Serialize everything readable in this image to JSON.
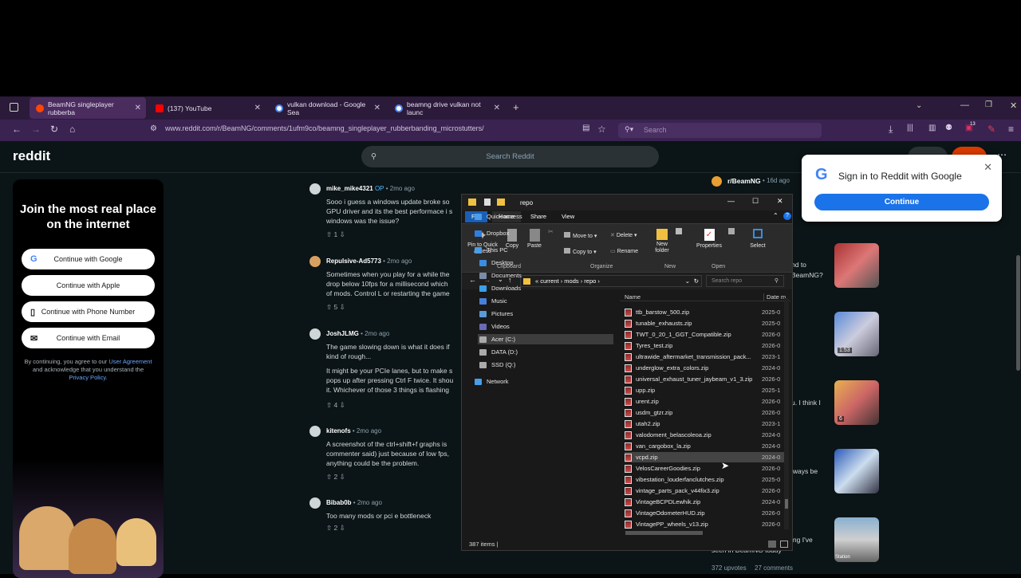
{
  "browser": {
    "tabs": [
      {
        "title": "BeamNG singleplayer rubberba",
        "color": "#ff4500"
      },
      {
        "title": "(137) YouTube",
        "color": "#ff0000"
      },
      {
        "title": "vulkan download - Google Sea",
        "color": "#4285f4"
      },
      {
        "title": "beamng drive vulkan not launc",
        "color": "#4285f4"
      }
    ],
    "url": "www.reddit.com/r/BeamNG/comments/1ufm9co/beamng_singleplayer_rubberbanding_microstutters/",
    "search_placeholder": "Search",
    "badge_count": "13"
  },
  "reddit": {
    "logo": "reddit",
    "search_placeholder": "Search Reddit",
    "join": {
      "title": "Join the most real place on the internet",
      "buttons": [
        "Continue with Google",
        "Continue with Apple",
        "Continue with Phone Number",
        "Continue with Email"
      ],
      "terms_pre": "By continuing, you agree to our",
      "terms_link1": "User Agreement",
      "terms_mid": "and acknowledge that you understand the",
      "terms_link2": "Privacy Policy."
    },
    "comments": [
      {
        "user": "mike_mike4321",
        "op": "OP",
        "time": "• 2mo ago",
        "lines": [
          "Sooo i guess a windows update broke so",
          "GPU driver and its the best performace i s",
          "windows was the issue?"
        ],
        "votes": "1"
      },
      {
        "user": "Repulsive-Ad5773",
        "op": "",
        "time": "• 2mo ago",
        "lines": [
          "Sometimes when you play for a while the",
          "drop below 10fps for a millisecond which",
          "of mods. Control L or restarting the game"
        ],
        "votes": "5"
      },
      {
        "user": "JoshJLMG",
        "op": "",
        "time": "• 2mo ago",
        "lines": [
          "The game slowing down is what it does if",
          "kind of rough...",
          "",
          "It might be your PCIe lanes, but to make s",
          "pops up after pressing Ctrl F twice. It shou",
          "it. Whichever of those 3 things is flashing"
        ],
        "votes": "4"
      },
      {
        "user": "kitenofs",
        "op": "",
        "time": "• 2mo ago",
        "lines": [
          "A screenshot of the ctrl+shift+f graphs is",
          "commenter said) just because of low fps,",
          "anything could be the problem."
        ],
        "votes": "2"
      },
      {
        "user": "Bibab0b",
        "op": "",
        "time": "• 2mo ago",
        "lines": [
          "Too many mods or pci e bottleneck"
        ],
        "votes": "2"
      }
    ],
    "side": {
      "subreddit": "r/BeamNG",
      "time": "• 16d ago",
      "snippets": [
        "nd to",
        "BeamNG?",
        "u. I think I",
        "lways be",
        "ing I've",
        "seen in BeamNG today"
      ],
      "video_time": "1:53",
      "gallery_count": "6",
      "thumb_label": "Station",
      "upvotes": "372 upvotes",
      "comments": "27 comments"
    }
  },
  "google_signin": {
    "title": "Sign in to Reddit with Google",
    "button": "Continue"
  },
  "explorer": {
    "title": "repo",
    "tabs": [
      "File",
      "Home",
      "Share",
      "View"
    ],
    "ribbon": {
      "pin": "Pin to Quick access",
      "copy": "Copy",
      "paste": "Paste",
      "move_to": "Move to",
      "copy_to": "Copy to",
      "delete": "Delete",
      "rename": "Rename",
      "new_folder": "New folder",
      "properties": "Properties",
      "select": "Select",
      "groups": [
        "Clipboard",
        "Organize",
        "New",
        "Open"
      ]
    },
    "path": [
      "current",
      "mods",
      "repo"
    ],
    "search_placeholder": "Search repo",
    "nav": [
      {
        "label": "Quick access",
        "color": "#4a9de8"
      },
      {
        "label": "Dropbox",
        "color": "#2f7fe0"
      },
      {
        "label": "This PC",
        "color": "#4a9de8"
      },
      {
        "label": "Desktop",
        "color": "#3a8de0"
      },
      {
        "label": "Documents",
        "color": "#7a8ca8"
      },
      {
        "label": "Downloads",
        "color": "#3aa0e8"
      },
      {
        "label": "Music",
        "color": "#4a7fd8"
      },
      {
        "label": "Pictures",
        "color": "#5a9ad8"
      },
      {
        "label": "Videos",
        "color": "#6a6ab8"
      },
      {
        "label": "Acer (C:)",
        "color": "#aaaaaa"
      },
      {
        "label": "DATA (D:)",
        "color": "#aaaaaa"
      },
      {
        "label": "SSD (Q:)",
        "color": "#aaaaaa"
      },
      {
        "label": "Network",
        "color": "#4a9de8"
      }
    ],
    "columns": [
      "Name",
      "Date m"
    ],
    "files": [
      {
        "name": "ttb_barstow_500.zip",
        "date": "2025-0"
      },
      {
        "name": "tunable_exhausts.zip",
        "date": "2025-0"
      },
      {
        "name": "TWT_0_20_1_GGT_Compatible.zip",
        "date": "2026-0"
      },
      {
        "name": "Tyres_test.zip",
        "date": "2026-0"
      },
      {
        "name": "ultrawide_aftermarket_transmission_pack...",
        "date": "2023-1"
      },
      {
        "name": "underglow_extra_colors.zip",
        "date": "2024-0"
      },
      {
        "name": "universal_exhaust_tuner_jaybeam_v1_3.zip",
        "date": "2026-0"
      },
      {
        "name": "upp.zip",
        "date": "2025-1"
      },
      {
        "name": "urent.zip",
        "date": "2026-0"
      },
      {
        "name": "usdm_gtzr.zip",
        "date": "2026-0"
      },
      {
        "name": "utah2.zip",
        "date": "2023-1"
      },
      {
        "name": "valodoment_belascoleoa.zip",
        "date": "2024-0"
      },
      {
        "name": "van_cargobox_la.zip",
        "date": "2024-0"
      },
      {
        "name": "vcpd.zip",
        "date": "2024-0"
      },
      {
        "name": "VelosCareerGoodies.zip",
        "date": "2026-0"
      },
      {
        "name": "vibestation_louderfanclutches.zip",
        "date": "2025-0"
      },
      {
        "name": "vintage_parts_pack_v44fix3.zip",
        "date": "2026-0"
      },
      {
        "name": "VintageBCPDLewhik.zip",
        "date": "2024-0"
      },
      {
        "name": "VintageOdometerHUD.zip",
        "date": "2026-0"
      },
      {
        "name": "VintagePP_wheels_v13.zip",
        "date": "2026-0"
      }
    ],
    "status": "387 items"
  }
}
